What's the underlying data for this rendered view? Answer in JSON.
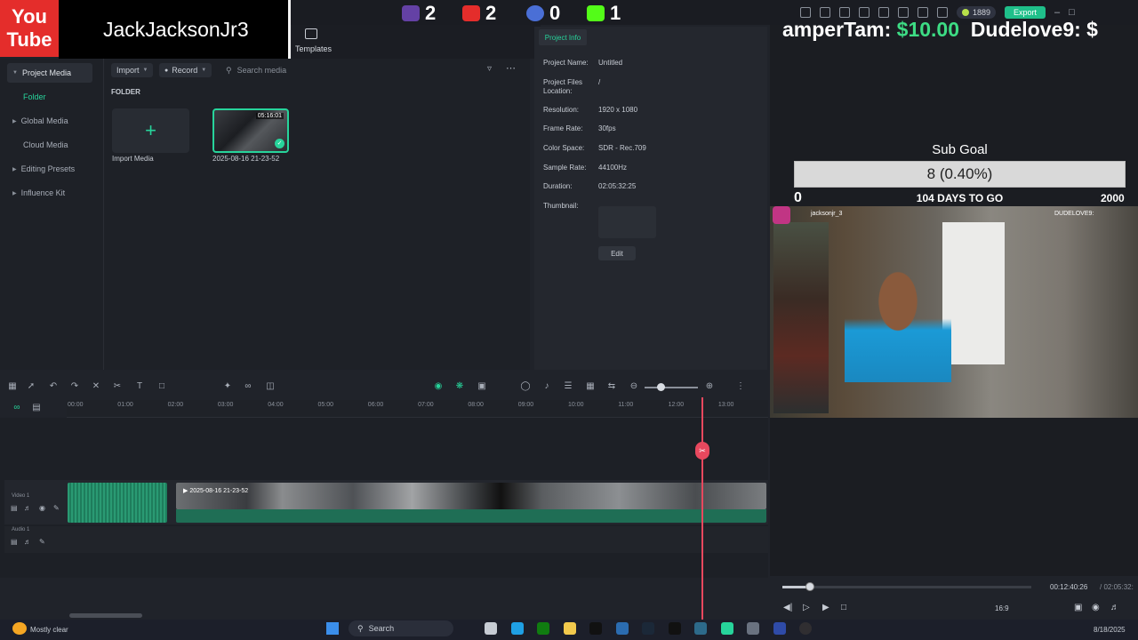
{
  "overlay": {
    "yt_logo": "You\nTube",
    "channel_name": "JackJacksonJr3",
    "counts": [
      {
        "platform": "twitch",
        "value": "2",
        "color": "#6441a5"
      },
      {
        "platform": "youtube",
        "value": "2",
        "color": "#e42d2b"
      },
      {
        "platform": "other",
        "value": "0",
        "color": "#4a6fd6"
      },
      {
        "platform": "kick",
        "value": "1",
        "color": "#53fc18"
      }
    ],
    "ticker_prefix": "amperTam: ",
    "ticker_amount": "$10.00",
    "ticker_next": "  Dudelove9: $"
  },
  "topbar": {
    "coins": "1889",
    "export_label": "Export",
    "templates_label": "Templates"
  },
  "left_nav": {
    "items": [
      {
        "label": "Project Media"
      },
      {
        "label": "Folder"
      },
      {
        "label": "Global Media"
      },
      {
        "label": "Cloud Media"
      },
      {
        "label": "Editing Presets"
      },
      {
        "label": "Influence Kit"
      }
    ]
  },
  "media": {
    "import_label": "Import",
    "record_label": "Record",
    "search_placeholder": "Search media",
    "folder_heading": "FOLDER",
    "import_tile_label": "Import Media",
    "clip_name": "2025-08-16 21-23-52",
    "clip_duration": "05:16:01"
  },
  "project_info": {
    "tab_label": "Project Info",
    "rows": [
      {
        "key": "Project Name:",
        "value": "Untitled"
      },
      {
        "key": "Project Files Location:",
        "value": "/"
      },
      {
        "key": "Resolution:",
        "value": "1920 x 1080"
      },
      {
        "key": "Frame Rate:",
        "value": "30fps"
      },
      {
        "key": "Color Space:",
        "value": "SDR - Rec.709"
      },
      {
        "key": "Sample Rate:",
        "value": "44100Hz"
      },
      {
        "key": "Duration:",
        "value": "02:05:32:25"
      },
      {
        "key": "Thumbnail:",
        "value": ""
      }
    ],
    "edit_label": "Edit"
  },
  "sub_goal": {
    "title": "Sub Goal",
    "progress_text": "8 (0.40%)",
    "progress": 0.004,
    "min": "0",
    "days_to_go": "104 DAYS TO GO",
    "max": "2000"
  },
  "webcam": {
    "ig_name": "jacksonjr_3",
    "tag": "DUDELOVE9:"
  },
  "player": {
    "current_time": "00:12:40:26",
    "total_time": "/ 02:05:32:",
    "aspect": "16:9",
    "progress": 0.1
  },
  "timeline": {
    "ticks": [
      "00:00",
      "01:00",
      "02:00",
      "03:00",
      "04:00",
      "05:00",
      "06:00",
      "07:00",
      "08:00",
      "09:00",
      "10:00",
      "11:00",
      "12:00",
      "13:00"
    ],
    "video_track_label": "Video 1",
    "audio_track_label": "Audio 1",
    "clip_label": "2025-08-16 21-23-52"
  },
  "taskbar": {
    "weather": "Mostly clear",
    "search_label": "Search",
    "date": "8/18/2025"
  }
}
